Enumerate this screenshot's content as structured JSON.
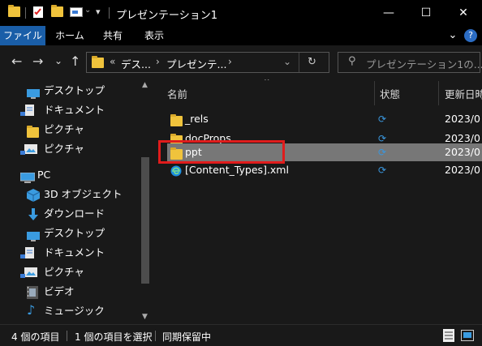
{
  "window": {
    "title": "プレゼンテーション1",
    "minimize_glyph": "—",
    "maximize_glyph": "☐",
    "close_glyph": "✕"
  },
  "ribbon": {
    "tabs": [
      {
        "label": "ファイル"
      },
      {
        "label": "ホーム"
      },
      {
        "label": "共有"
      },
      {
        "label": "表示"
      }
    ],
    "collapse_glyph": "⌄",
    "help_glyph": "?"
  },
  "address": {
    "overflow": "«",
    "crumb1": "デス...",
    "crumb2": "プレゼンテ...",
    "sep": "›",
    "search_placeholder": "プレゼンテーション1の..."
  },
  "nav": {
    "items": [
      {
        "label": "デスクトップ",
        "icon": "desktop-icon"
      },
      {
        "label": "ドキュメント",
        "icon": "documents-icon"
      },
      {
        "label": "ピクチャ",
        "icon": "folder-icon"
      },
      {
        "label": "ピクチャ",
        "icon": "pictures-icon"
      },
      {
        "label": "PC",
        "icon": "pc-icon"
      },
      {
        "label": "3D オブジェクト",
        "icon": "3d-objects-icon"
      },
      {
        "label": "ダウンロード",
        "icon": "download-icon"
      },
      {
        "label": "デスクトップ",
        "icon": "desktop-icon"
      },
      {
        "label": "ドキュメント",
        "icon": "documents-icon"
      },
      {
        "label": "ピクチャ",
        "icon": "pictures-icon"
      },
      {
        "label": "ビデオ",
        "icon": "video-icon"
      },
      {
        "label": "ミュージック",
        "icon": "music-icon"
      }
    ]
  },
  "columns": {
    "name": "名前",
    "status": "状態",
    "modified": "更新日時"
  },
  "files": [
    {
      "name": "_rels",
      "type": "folder",
      "date": "2023/0"
    },
    {
      "name": "docProps",
      "type": "folder",
      "date": "2023/0"
    },
    {
      "name": "ppt",
      "type": "folder",
      "date": "2023/0"
    },
    {
      "name": "[Content_Types].xml",
      "type": "xml",
      "date": "2023/0"
    }
  ],
  "status": {
    "item_count": "4 個の項目",
    "selected": "1 個の項目を選択",
    "sync": "同期保留中"
  },
  "colors": {
    "accent": "#1a5ea8",
    "highlight_box": "#e01c1c",
    "sync_icon": "#3a96dd"
  }
}
